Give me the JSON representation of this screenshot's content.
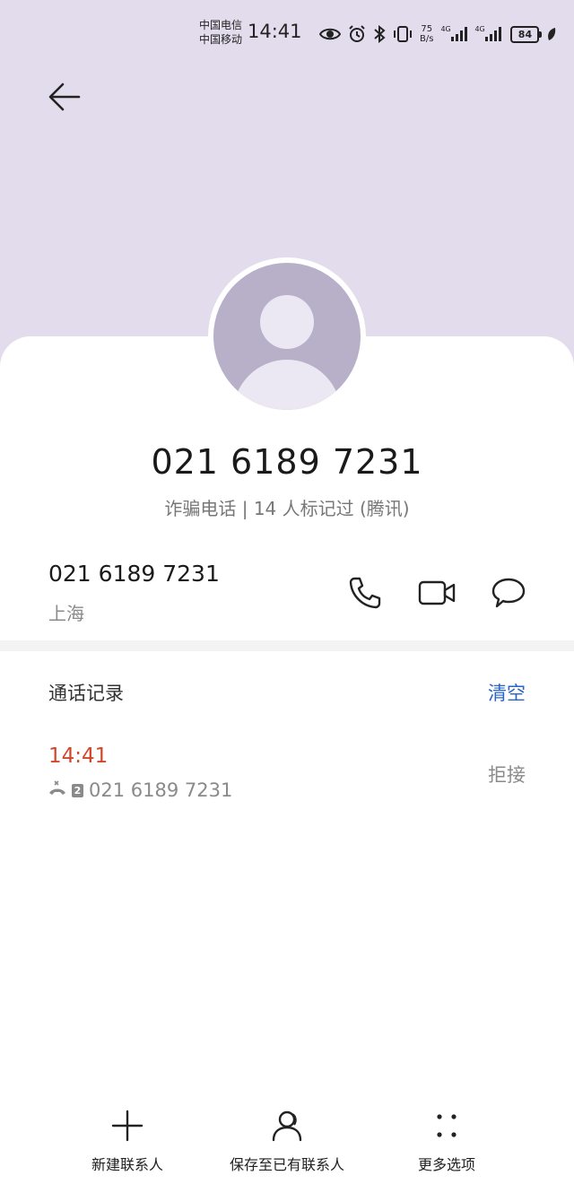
{
  "status_bar": {
    "carrier_1": "中国电信",
    "carrier_2": "中国移动",
    "time": "14:41",
    "net_speed_value": "75",
    "net_speed_unit": "B/s",
    "signal_1_label": "4G",
    "signal_2_label": "4G",
    "battery": "84",
    "icons": [
      "eye-icon",
      "alarm-icon",
      "bluetooth-icon",
      "vibrate-icon",
      "signal-icon",
      "signal-icon",
      "battery-icon",
      "leaf-icon"
    ]
  },
  "contact": {
    "title": "021 6189 7231",
    "subtitle": "诈骗电话 | 14 人标记过 (腾讯)"
  },
  "number_row": {
    "number": "021 6189 7231",
    "location": "上海",
    "actions": [
      "phone-icon",
      "video-call-icon",
      "message-icon"
    ]
  },
  "history": {
    "title": "通话记录",
    "clear_label": "清空",
    "entries": [
      {
        "time": "14:41",
        "sim": "2",
        "number": "021 6189 7231",
        "status": "拒接"
      }
    ]
  },
  "bottom_bar": {
    "items": [
      {
        "label": "新建联系人",
        "icon": "plus-icon"
      },
      {
        "label": "保存至已有联系人",
        "icon": "person-icon"
      },
      {
        "label": "更多选项",
        "icon": "more-dots-icon"
      }
    ]
  },
  "colors": {
    "header_bg": "#e3dcec",
    "accent_blue": "#2a64c8",
    "missed_red": "#d0472b"
  }
}
